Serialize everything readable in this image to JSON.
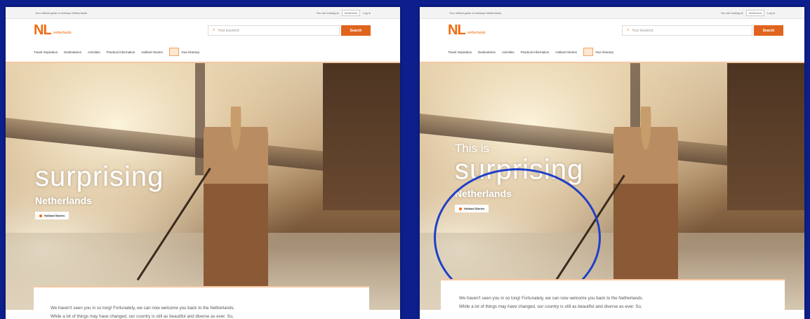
{
  "site": {
    "tagline": "Your official guide to holidays Netherlands",
    "lang_label": "You are looking at",
    "lang_value": "Nederland",
    "login": "Log in",
    "logo_text": "NL",
    "logo_sub": "netherlands"
  },
  "search": {
    "placeholder": "Your keyword",
    "button": "Search"
  },
  "nav": {
    "items": [
      "Travel inspiration",
      "Destinations",
      "Activities",
      "Practical information",
      "Holland Stories"
    ],
    "favorites": "Your itinerary"
  },
  "hero": {
    "pretitle": "This is",
    "title": "surprising",
    "subtitle": "Netherlands",
    "badge": "Holland Stories"
  },
  "intro": {
    "line1": "We haven't seen you in so long! Fortunately, we can now welcome you back to the Netherlands.",
    "line2": "While a lot of things may have changed, our country is still as beautiful and diverse as ever. So,"
  },
  "colors": {
    "accent": "#f26a10",
    "frame": "#0c1f8c",
    "annotation": "#1f3fc8"
  }
}
